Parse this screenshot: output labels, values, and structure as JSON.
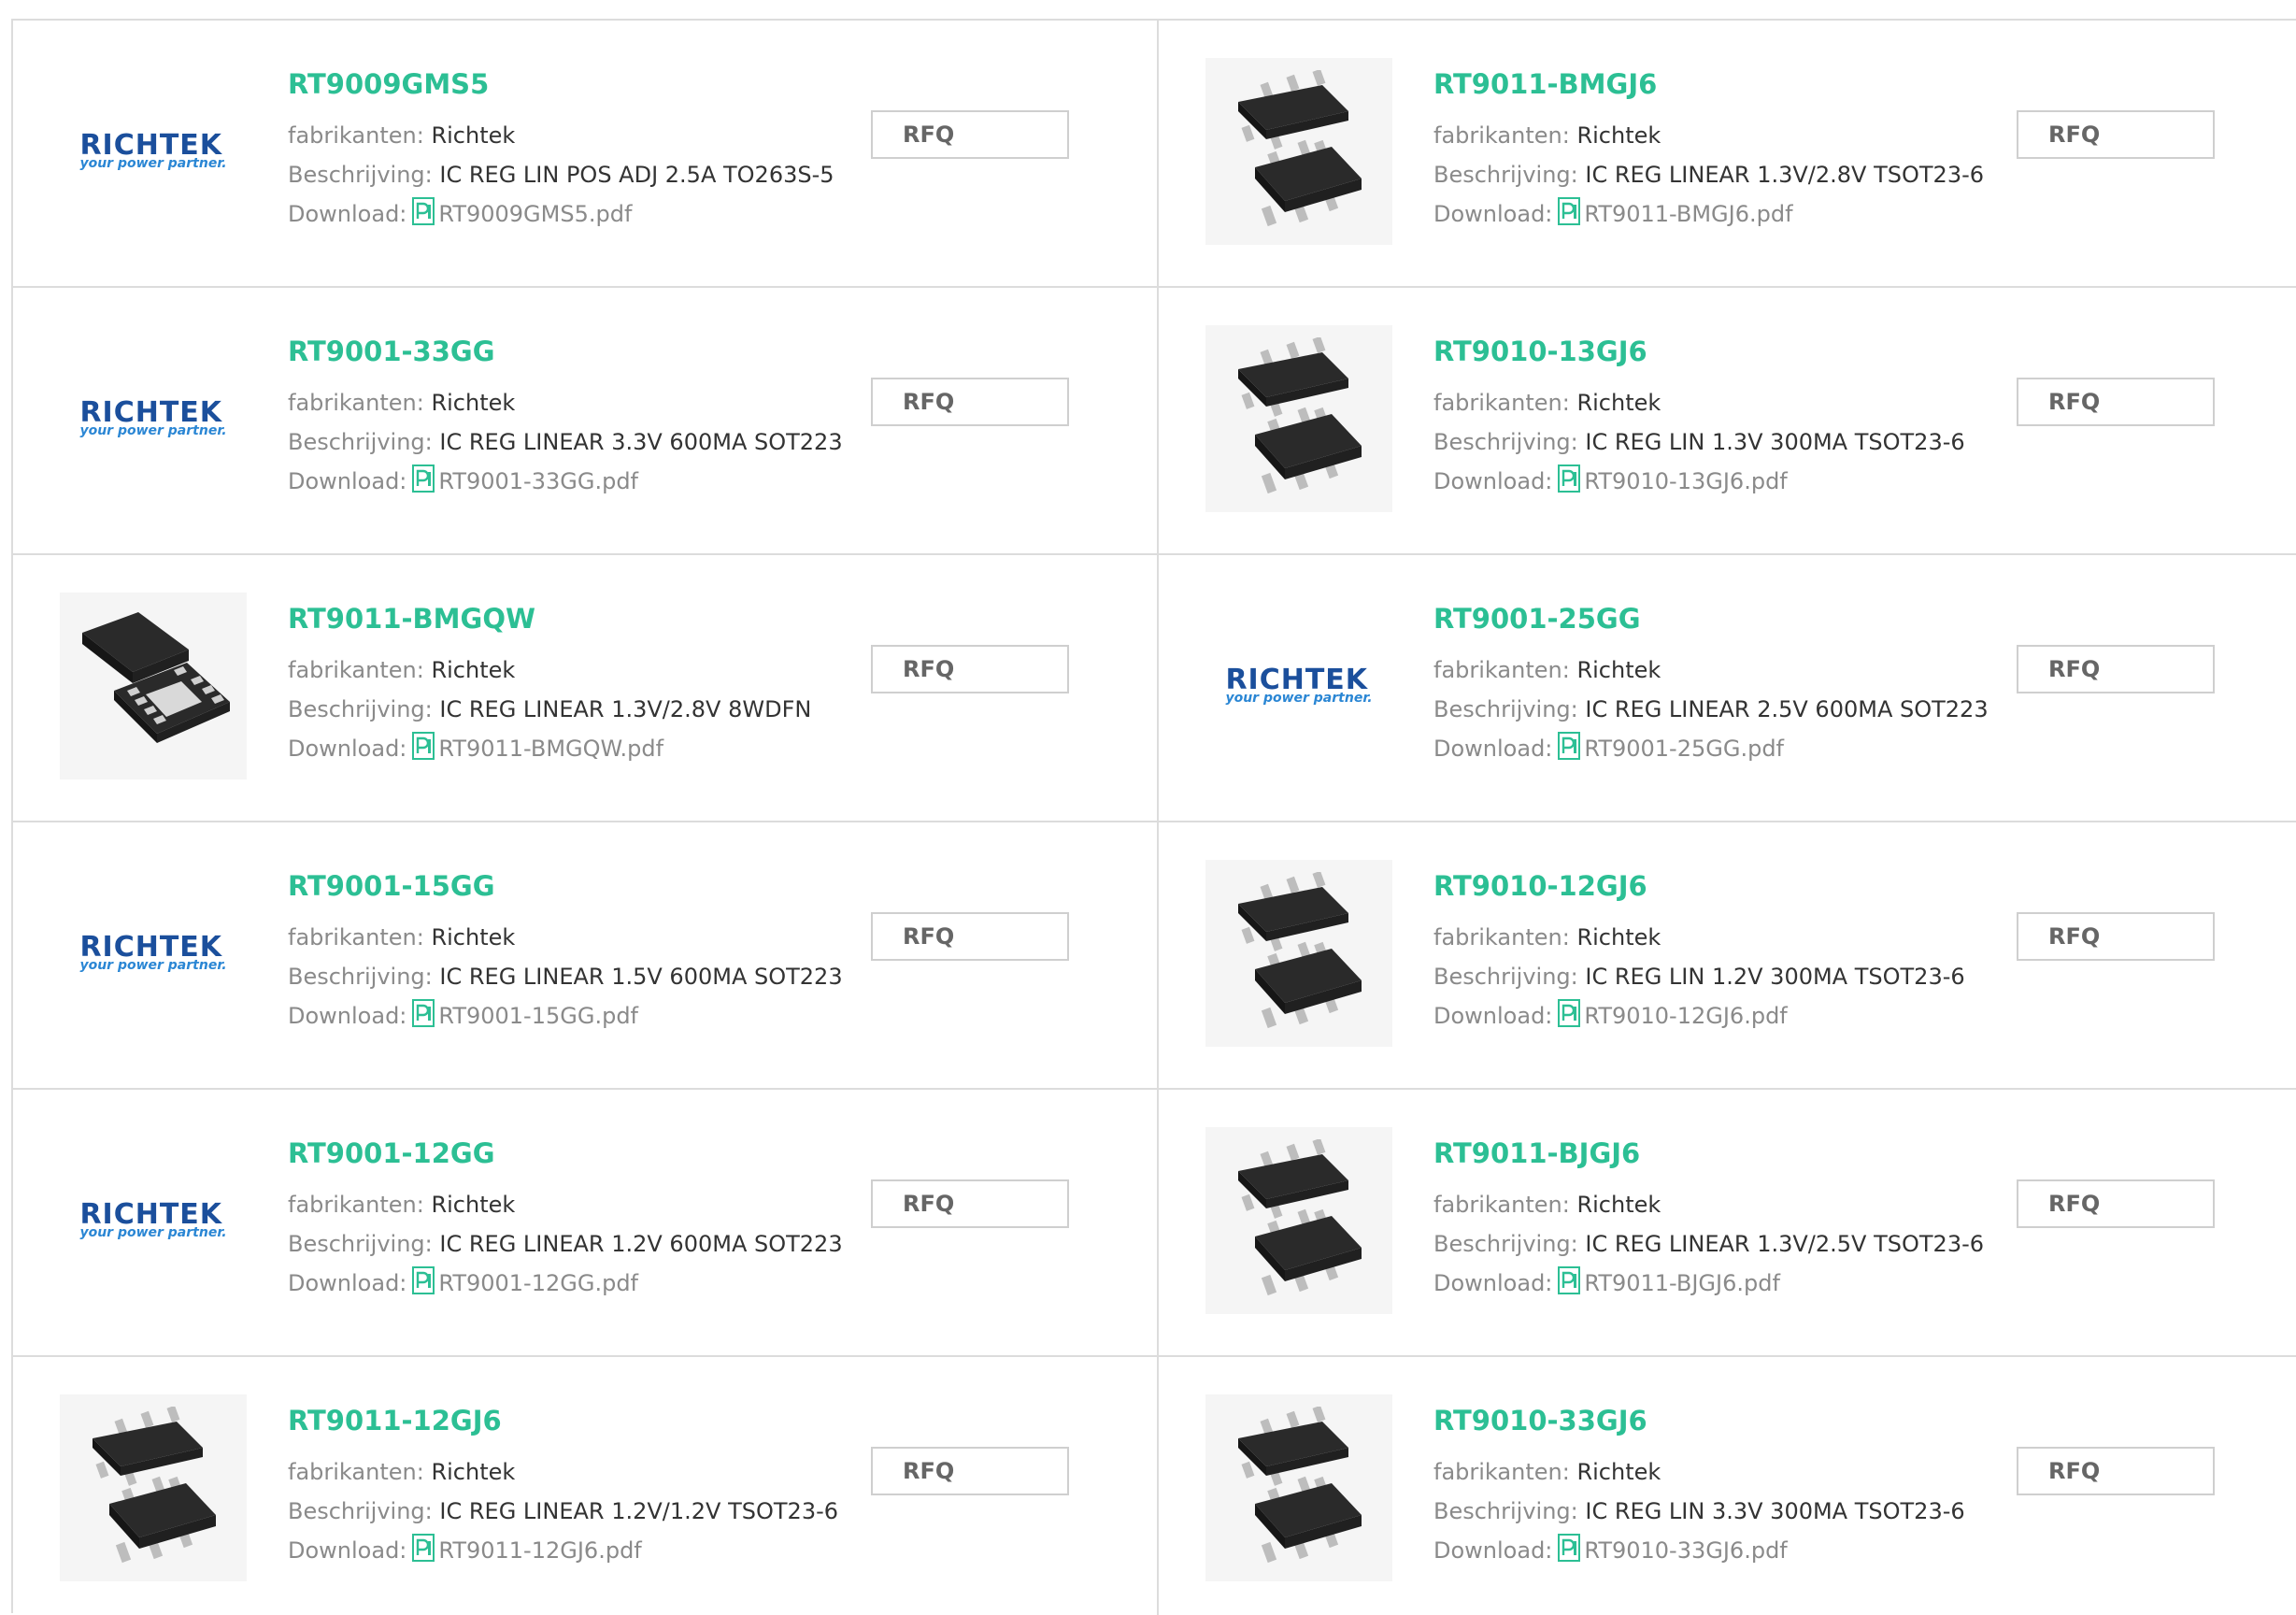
{
  "labels": {
    "manufacturer": "fabrikanten:",
    "description": "Beschrijving:",
    "download": "Download:",
    "rfq": "RFQ"
  },
  "colors": {
    "part_number": "#2cbf94",
    "label": "#8a8a8a",
    "logo_blue": "#1b4f9c"
  },
  "logo": {
    "word": "RICHTEK",
    "tagline": "your power partner."
  },
  "products": [
    {
      "part": "RT9009GMS5",
      "manufacturer": "Richtek",
      "description": "IC REG LIN POS ADJ 2.5A TO263S-5",
      "pdf": "RT9009GMS5.pdf",
      "image": "richtek-logo"
    },
    {
      "part": "RT9011-BMGJ6",
      "manufacturer": "Richtek",
      "description": "IC REG LINEAR 1.3V/2.8V TSOT23-6",
      "pdf": "RT9011-BMGJ6.pdf",
      "image": "sot23-6-chip"
    },
    {
      "part": "RT9001-33GG",
      "manufacturer": "Richtek",
      "description": "IC REG LINEAR 3.3V 600MA SOT223",
      "pdf": "RT9001-33GG.pdf",
      "image": "richtek-logo"
    },
    {
      "part": "RT9010-13GJ6",
      "manufacturer": "Richtek",
      "description": "IC REG LIN 1.3V 300MA TSOT23-6",
      "pdf": "RT9010-13GJ6.pdf",
      "image": "sot23-6-chip"
    },
    {
      "part": "RT9011-BMGQW",
      "manufacturer": "Richtek",
      "description": "IC REG LINEAR 1.3V/2.8V 8WDFN",
      "pdf": "RT9011-BMGQW.pdf",
      "image": "wdfn-8-chip"
    },
    {
      "part": "RT9001-25GG",
      "manufacturer": "Richtek",
      "description": "IC REG LINEAR 2.5V 600MA SOT223",
      "pdf": "RT9001-25GG.pdf",
      "image": "richtek-logo"
    },
    {
      "part": "RT9001-15GG",
      "manufacturer": "Richtek",
      "description": "IC REG LINEAR 1.5V 600MA SOT223",
      "pdf": "RT9001-15GG.pdf",
      "image": "richtek-logo"
    },
    {
      "part": "RT9010-12GJ6",
      "manufacturer": "Richtek",
      "description": "IC REG LIN 1.2V 300MA TSOT23-6",
      "pdf": "RT9010-12GJ6.pdf",
      "image": "sot23-6-chip"
    },
    {
      "part": "RT9001-12GG",
      "manufacturer": "Richtek",
      "description": "IC REG LINEAR 1.2V 600MA SOT223",
      "pdf": "RT9001-12GG.pdf",
      "image": "richtek-logo"
    },
    {
      "part": "RT9011-BJGJ6",
      "manufacturer": "Richtek",
      "description": "IC REG LINEAR 1.3V/2.5V TSOT23-6",
      "pdf": "RT9011-BJGJ6.pdf",
      "image": "sot23-6-chip"
    },
    {
      "part": "RT9011-12GJ6",
      "manufacturer": "Richtek",
      "description": "IC REG LINEAR 1.2V/1.2V TSOT23-6",
      "pdf": "RT9011-12GJ6.pdf",
      "image": "sot23-6-chip"
    },
    {
      "part": "RT9010-33GJ6",
      "manufacturer": "Richtek",
      "description": "IC REG LIN 3.3V 300MA TSOT23-6",
      "pdf": "RT9010-33GJ6.pdf",
      "image": "sot23-6-chip"
    }
  ]
}
